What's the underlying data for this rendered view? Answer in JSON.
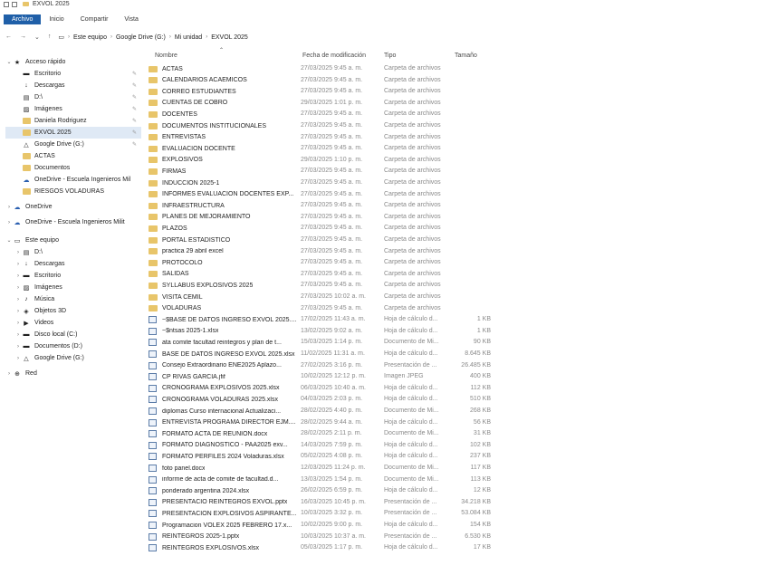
{
  "window": {
    "title": "EXVOL 2025"
  },
  "ribbon": {
    "tabs": [
      "Archivo",
      "Inicio",
      "Compartir",
      "Vista"
    ]
  },
  "address": {
    "crumbs": [
      "Este equipo",
      "Google Drive (G:)",
      "Mi unidad",
      "EXVOL 2025"
    ]
  },
  "columns": {
    "name": "Nombre",
    "date": "Fecha de modificación",
    "type": "Tipo",
    "size": "Tamaño"
  },
  "sidebar": {
    "items": [
      {
        "label": "Acceso rápido",
        "chevron": "⌄",
        "icon": "star-icon",
        "level": 0
      },
      {
        "label": "Escritorio",
        "icon": "desktop-icon",
        "pin": true,
        "level": 1
      },
      {
        "label": "Descargas",
        "icon": "download-icon",
        "pin": true,
        "level": 1
      },
      {
        "label": "D:\\",
        "icon": "drive-icon",
        "pin": true,
        "level": 1
      },
      {
        "label": "Imágenes",
        "icon": "images-icon",
        "pin": true,
        "level": 1
      },
      {
        "label": "Daniela Rodriguez",
        "icon": "folder-icon",
        "pin": true,
        "level": 1
      },
      {
        "label": "EXVOL 2025",
        "icon": "folder-icon",
        "pin": true,
        "level": 1,
        "selected": true
      },
      {
        "label": "Google Drive (G:)",
        "icon": "google-drive-icon",
        "pin": true,
        "level": 1
      },
      {
        "label": "ACTAS",
        "icon": "folder-icon",
        "level": 1
      },
      {
        "label": "Documentos",
        "icon": "folder-icon",
        "level": 1
      },
      {
        "label": "OneDrive - Escuela Ingenieros Mil",
        "icon": "onedrive-icon",
        "level": 1
      },
      {
        "label": "RIESGOS VOLADURAS",
        "icon": "folder-icon",
        "level": 1
      },
      {
        "label": "OneDrive",
        "chevron": "›",
        "icon": "onedrive-icon",
        "level": 0
      },
      {
        "label": "OneDrive - Escuela Ingenieros Milit",
        "chevron": "›",
        "icon": "onedrive-icon",
        "level": 0
      },
      {
        "label": "Este equipo",
        "chevron": "⌄",
        "icon": "computer-icon",
        "level": 0
      },
      {
        "label": "D:\\",
        "chevron": "›",
        "icon": "drive-icon",
        "level": 1
      },
      {
        "label": "Descargas",
        "chevron": "›",
        "icon": "download-icon",
        "level": 1
      },
      {
        "label": "Escritorio",
        "chevron": "›",
        "icon": "desktop-icon",
        "level": 1
      },
      {
        "label": "Imágenes",
        "chevron": "›",
        "icon": "images-icon",
        "level": 1
      },
      {
        "label": "Música",
        "chevron": "›",
        "icon": "music-icon",
        "level": 1
      },
      {
        "label": "Objetos 3D",
        "chevron": "›",
        "icon": "cube-icon",
        "level": 1
      },
      {
        "label": "Videos",
        "chevron": "›",
        "icon": "video-icon",
        "level": 1
      },
      {
        "label": "Disco local (C:)",
        "chevron": "›",
        "icon": "disk-icon",
        "level": 1
      },
      {
        "label": "Documentos (D:)",
        "chevron": "›",
        "icon": "disk-icon",
        "level": 1
      },
      {
        "label": "Google Drive (G:)",
        "chevron": "›",
        "icon": "google-drive-icon",
        "level": 1
      },
      {
        "label": "Red",
        "chevron": "›",
        "icon": "network-icon",
        "level": 0
      }
    ]
  },
  "files": [
    {
      "name": "ACTAS",
      "kind": "folder",
      "date": "27/03/2025 9:45 a. m.",
      "type": "Carpeta de archivos",
      "size": ""
    },
    {
      "name": "CALENDARIOS ACAEMICOS",
      "kind": "folder",
      "date": "27/03/2025 9:45 a. m.",
      "type": "Carpeta de archivos",
      "size": ""
    },
    {
      "name": "CORREO ESTUDIANTES",
      "kind": "folder",
      "date": "27/03/2025 9:45 a. m.",
      "type": "Carpeta de archivos",
      "size": ""
    },
    {
      "name": "CUENTAS DE COBRO",
      "kind": "folder",
      "date": "29/03/2025 1:01 p. m.",
      "type": "Carpeta de archivos",
      "size": ""
    },
    {
      "name": "DOCENTES",
      "kind": "folder",
      "date": "27/03/2025 9:45 a. m.",
      "type": "Carpeta de archivos",
      "size": ""
    },
    {
      "name": "DOCUMENTOS INSTITUCIONALES",
      "kind": "folder",
      "date": "27/03/2025 9:45 a. m.",
      "type": "Carpeta de archivos",
      "size": ""
    },
    {
      "name": "ENTREVISTAS",
      "kind": "folder",
      "date": "27/03/2025 9:45 a. m.",
      "type": "Carpeta de archivos",
      "size": ""
    },
    {
      "name": "EVALUACION DOCENTE",
      "kind": "folder",
      "date": "27/03/2025 9:45 a. m.",
      "type": "Carpeta de archivos",
      "size": ""
    },
    {
      "name": "EXPLOSIVOS",
      "kind": "folder",
      "date": "29/03/2025 1:10 p. m.",
      "type": "Carpeta de archivos",
      "size": ""
    },
    {
      "name": "FIRMAS",
      "kind": "folder",
      "date": "27/03/2025 9:45 a. m.",
      "type": "Carpeta de archivos",
      "size": ""
    },
    {
      "name": "INDUCCION 2025-1",
      "kind": "folder",
      "date": "27/03/2025 9:45 a. m.",
      "type": "Carpeta de archivos",
      "size": ""
    },
    {
      "name": "INFORMES EVALUACION DOCENTES EXP...",
      "kind": "folder",
      "date": "27/03/2025 9:45 a. m.",
      "type": "Carpeta de archivos",
      "size": ""
    },
    {
      "name": "INFRAESTRUCTURA",
      "kind": "folder",
      "date": "27/03/2025 9:45 a. m.",
      "type": "Carpeta de archivos",
      "size": ""
    },
    {
      "name": "PLANES DE MEJORAMIENTO",
      "kind": "folder",
      "date": "27/03/2025 9:45 a. m.",
      "type": "Carpeta de archivos",
      "size": ""
    },
    {
      "name": "PLAZOS",
      "kind": "folder",
      "date": "27/03/2025 9:45 a. m.",
      "type": "Carpeta de archivos",
      "size": ""
    },
    {
      "name": "PORTAL ESTADISTICO",
      "kind": "folder",
      "date": "27/03/2025 9:45 a. m.",
      "type": "Carpeta de archivos",
      "size": ""
    },
    {
      "name": "practica 29 abril excel",
      "kind": "folder",
      "date": "27/03/2025 9:45 a. m.",
      "type": "Carpeta de archivos",
      "size": ""
    },
    {
      "name": "PROTOCOLO",
      "kind": "folder",
      "date": "27/03/2025 9:45 a. m.",
      "type": "Carpeta de archivos",
      "size": ""
    },
    {
      "name": "SALIDAS",
      "kind": "folder",
      "date": "27/03/2025 9:45 a. m.",
      "type": "Carpeta de archivos",
      "size": ""
    },
    {
      "name": "SYLLABUS EXPLOSIVOS 2025",
      "kind": "folder",
      "date": "27/03/2025 9:45 a. m.",
      "type": "Carpeta de archivos",
      "size": ""
    },
    {
      "name": "VISITA CEMIL",
      "kind": "folder",
      "date": "27/03/2025 10:02 a. m.",
      "type": "Carpeta de archivos",
      "size": ""
    },
    {
      "name": "VOLADURAS",
      "kind": "folder",
      "date": "27/03/2025 9:45 a. m.",
      "type": "Carpeta de archivos",
      "size": ""
    },
    {
      "name": "~$BASE DE DATOS INGRESO EXVOL 2025....",
      "kind": "file",
      "date": "17/02/2025 11:43 a. m.",
      "type": "Hoja de cálculo d...",
      "size": "1 KB"
    },
    {
      "name": "~$ntsas 2025-1.xlsx",
      "kind": "file",
      "date": "13/02/2025 9:02 a. m.",
      "type": "Hoja de cálculo d...",
      "size": "1 KB"
    },
    {
      "name": "ata comite facultad reintegros y plan de t...",
      "kind": "file",
      "date": "15/03/2025 1:14 p. m.",
      "type": "Documento de Mi...",
      "size": "90 KB"
    },
    {
      "name": "BASE DE DATOS INGRESO EXVOL 2025.xlsx",
      "kind": "file",
      "date": "11/02/2025 11:31 a. m.",
      "type": "Hoja de cálculo d...",
      "size": "8.645 KB"
    },
    {
      "name": "Consejo Extraordinario ENE2025 Aplazo...",
      "kind": "file",
      "date": "27/02/2025 3:16 p. m.",
      "type": "Presentación de ...",
      "size": "26.485 KB"
    },
    {
      "name": "CP RIVAS GARCIA.jfif",
      "kind": "file",
      "date": "10/02/2025 12:12 p. m.",
      "type": "Imagen JPEG",
      "size": "400 KB"
    },
    {
      "name": "CRONOGRAMA EXPLOSIVOS 2025.xlsx",
      "kind": "file",
      "date": "06/03/2025 10:40 a. m.",
      "type": "Hoja de cálculo d...",
      "size": "112 KB"
    },
    {
      "name": "CRONOGRAMA VOLADURAS 2025.xlsx",
      "kind": "file",
      "date": "04/03/2025 2:03 p. m.",
      "type": "Hoja de cálculo d...",
      "size": "510 KB"
    },
    {
      "name": "diplomas Curso internacional Actualizaci...",
      "kind": "file",
      "date": "28/02/2025 4:40 p. m.",
      "type": "Documento de Mi...",
      "size": "268 KB"
    },
    {
      "name": "ENTREVISTA PROGRAMA DIRECTOR EJM....",
      "kind": "file",
      "date": "28/02/2025 9:44 a. m.",
      "type": "Hoja de cálculo d...",
      "size": "56 KB"
    },
    {
      "name": "FORMATO ACTA DE REUNION.docx",
      "kind": "file",
      "date": "28/02/2025 2:11 p. m.",
      "type": "Documento de Mi...",
      "size": "31 KB"
    },
    {
      "name": "FORMATO DIAGNOSTICO - PAA2025 exv...",
      "kind": "file",
      "date": "14/03/2025 7:59 p. m.",
      "type": "Hoja de cálculo d...",
      "size": "102 KB"
    },
    {
      "name": "FORMATO PERFILES 2024 Voladuras.xlsx",
      "kind": "file",
      "date": "05/02/2025 4:08 p. m.",
      "type": "Hoja de cálculo d...",
      "size": "237 KB"
    },
    {
      "name": "foto panel.docx",
      "kind": "file",
      "date": "12/03/2025 11:24 p. m.",
      "type": "Documento de Mi...",
      "size": "117 KB"
    },
    {
      "name": "informe de acta de comite de facultad.d...",
      "kind": "file",
      "date": "13/03/2025 1:54 p. m.",
      "type": "Documento de Mi...",
      "size": "113 KB"
    },
    {
      "name": "ponderado argentina 2024.xlsx",
      "kind": "file",
      "date": "26/02/2025 6:59 p. m.",
      "type": "Hoja de cálculo d...",
      "size": "12 KB"
    },
    {
      "name": "PRESENTACIO REINTEGROS EXVOL.pptx",
      "kind": "file",
      "date": "16/03/2025 10:45 p. m.",
      "type": "Presentación de ...",
      "size": "34.218 KB"
    },
    {
      "name": "PRESENTACION EXPLOSIVOS ASPIRANTE...",
      "kind": "file",
      "date": "10/03/2025 3:32 p. m.",
      "type": "Presentación de ...",
      "size": "53.084 KB"
    },
    {
      "name": "Programacion VOLEX 2025 FEBRERO 17.x...",
      "kind": "file",
      "date": "10/02/2025 9:00 p. m.",
      "type": "Hoja de cálculo d...",
      "size": "154 KB"
    },
    {
      "name": "REINTEGROS 2025-1.pptx",
      "kind": "file",
      "date": "10/03/2025 10:37 a. m.",
      "type": "Presentación de ...",
      "size": "6.530 KB"
    },
    {
      "name": "REINTEGROS EXPLOSIVOS.xlsx",
      "kind": "file",
      "date": "05/03/2025 1:17 p. m.",
      "type": "Hoja de cálculo d...",
      "size": "17 KB"
    }
  ]
}
